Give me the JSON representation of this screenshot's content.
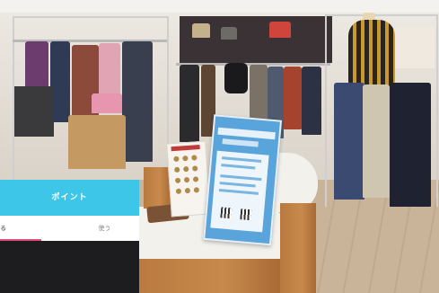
{
  "app": {
    "title": "ポイント",
    "tabs": [
      {
        "label": "る",
        "active": true
      },
      {
        "label": "使う",
        "active": false
      }
    ],
    "colors": {
      "header": "#3ec6e8",
      "tab_indicator": "#e24b7c",
      "body": "#1d1d1f"
    }
  }
}
